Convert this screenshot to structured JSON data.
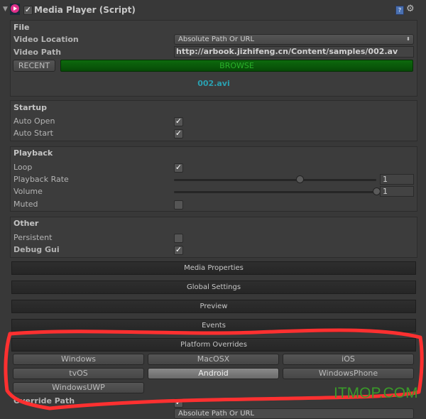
{
  "component": {
    "title": "Media Player (Script)",
    "enabled": true,
    "icons": [
      "foldout-arrow-icon",
      "media-player-logo-icon",
      "help-book-icon",
      "gear-icon"
    ]
  },
  "file": {
    "heading": "File",
    "video_location_label": "Video Location",
    "video_location_value": "Absolute Path Or URL",
    "video_path_label": "Video Path",
    "video_path_value": "http://arbook.jizhifeng.cn/Content/samples/002.av",
    "recent_label": "RECENT",
    "browse_label": "BROWSE",
    "file_name": "002.avi",
    "browse_color": "#0a6a0a",
    "file_name_color": "#2aa0b0"
  },
  "startup": {
    "heading": "Startup",
    "auto_open_label": "Auto Open",
    "auto_open": true,
    "auto_start_label": "Auto Start",
    "auto_start": true
  },
  "playback": {
    "heading": "Playback",
    "loop_label": "Loop",
    "loop": true,
    "rate_label": "Playback Rate",
    "rate_value": "1",
    "rate_slider_fraction": 0.62,
    "volume_label": "Volume",
    "volume_value": "1",
    "volume_slider_fraction": 1.0,
    "muted_label": "Muted",
    "muted": false
  },
  "other": {
    "heading": "Other",
    "persistent_label": "Persistent",
    "persistent": false,
    "debug_gui_label": "Debug Gui",
    "debug_gui": true
  },
  "sections": [
    "Media Properties",
    "Global Settings",
    "Preview",
    "Events",
    "Platform Overrides"
  ],
  "platforms": {
    "items": [
      "Windows",
      "MacOSX",
      "iOS",
      "tvOS",
      "Android",
      "WindowsPhone",
      "WindowsUWP"
    ],
    "selected": "Android"
  },
  "override": {
    "label": "Override Path",
    "checked": true,
    "location_value": "Absolute Path Or URL"
  },
  "annotation": {
    "color": "#ff3030"
  },
  "watermark": {
    "text": "ITMOP.COM",
    "color": "#3a9a2a"
  }
}
